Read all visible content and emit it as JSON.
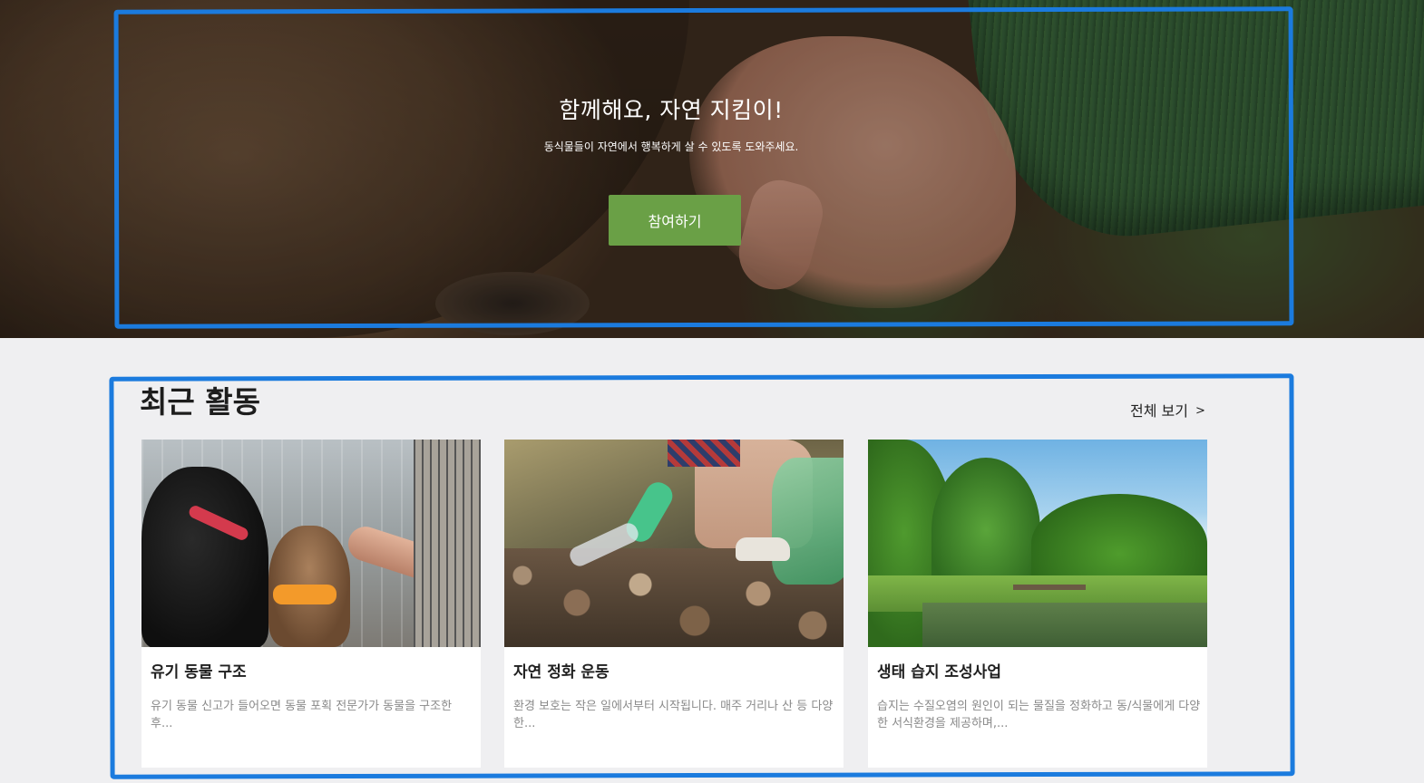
{
  "hero": {
    "headline": "함께해요, 자연 지킴이!",
    "subtext": "동식물들이 자연에서 행복하게 살 수 있도록 도와주세요.",
    "cta_label": "참여하기",
    "cta_color": "#6aa046"
  },
  "activities": {
    "section_title": "최근 활동",
    "view_all_label": "전체 보기",
    "view_all_icon": "chevron-right-icon",
    "cards": [
      {
        "title": "유기 동물 구조",
        "description": "유기 동물 신고가 들어오면 동물 포획 전문가가 동물을 구조한 후..."
      },
      {
        "title": "자연 정화 운동",
        "description": "환경 보호는 작은 일에서부터 시작됩니다. 매주 거리나 산 등 다양한..."
      },
      {
        "title": "생태 습지 조성사업",
        "description": "습지는 수질오염의 원인이 되는 물질을 정화하고 동/식물에게 다양한 서식환경을 제공하며,..."
      }
    ]
  },
  "colors": {
    "page_background": "#efeff1",
    "highlight_frame": "#1b7bde",
    "card_description": "#8a8a8a"
  }
}
